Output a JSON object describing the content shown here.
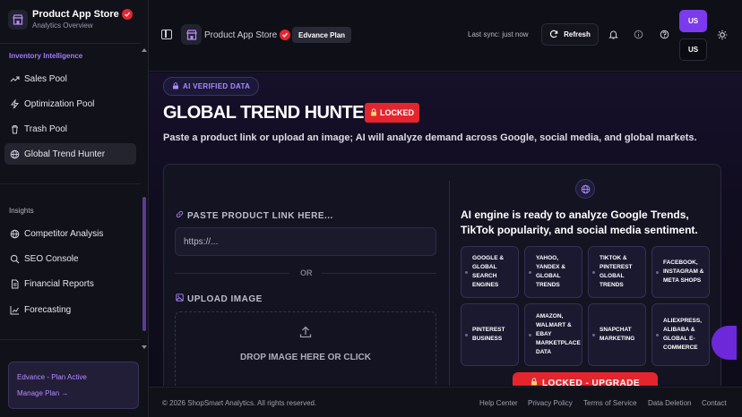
{
  "brand": {
    "title": "Product App Store",
    "subtitle": "Analytics Overview"
  },
  "sidebar": {
    "section_inventory": "Inventory Intelligence",
    "inventory_items": [
      {
        "label": "Sales Pool",
        "icon": "trending-up-icon"
      },
      {
        "label": "Optimization Pool",
        "icon": "bolt-icon"
      },
      {
        "label": "Trash Pool",
        "icon": "trash-icon"
      },
      {
        "label": "Global Trend Hunter",
        "icon": "globe-icon",
        "active": true
      }
    ],
    "section_insights": "Insights",
    "insight_items": [
      {
        "label": "Competitor Analysis",
        "icon": "globe-icon"
      },
      {
        "label": "SEO Console",
        "icon": "search-icon"
      },
      {
        "label": "Financial Reports",
        "icon": "document-icon"
      },
      {
        "label": "Forecasting",
        "icon": "chart-icon"
      }
    ],
    "plan": {
      "title": "Edvance - Plan Active",
      "link": "Manage Plan →"
    }
  },
  "topbar": {
    "app_name": "Product App Store",
    "plan_badge": "Edvance Plan",
    "sync": "Last sync: just now",
    "refresh": "Refresh",
    "lang_primary": "US",
    "lang_secondary": "US"
  },
  "main": {
    "ai_badge": "AI VERIFIED DATA",
    "title": "GLOBAL TREND HUNTER",
    "locked": "LOCKED",
    "subtitle": "Paste a product link or upload an image; AI will analyze demand across Google, social media, and global markets.",
    "link_label": "PASTE PRODUCT LINK HERE...",
    "link_placeholder": "https://...",
    "or": "OR",
    "upload_label": "UPLOAD IMAGE",
    "drop_text": "DROP IMAGE HERE OR CLICK",
    "ai_ready": "AI engine is ready to analyze Google Trends, TikTok popularity, and social media sentiment.",
    "sources": [
      [
        "GOOGLE &",
        "GLOBAL",
        "SEARCH",
        "ENGINES"
      ],
      [
        "YAHOO,",
        "YANDEX &",
        "GLOBAL",
        "TRENDS"
      ],
      [
        "TIKTOK &",
        "PINTEREST",
        "GLOBAL",
        "TRENDS"
      ],
      [
        "FACEBOOK,",
        "INSTAGRAM &",
        "META SHOPS"
      ],
      [
        "PINTEREST",
        "BUSINESS"
      ],
      [
        "AMAZON,",
        "WALMART &",
        "EBAY",
        "MARKETPLACE",
        "DATA"
      ],
      [
        "SNAPCHAT",
        "MARKETING"
      ],
      [
        "ALIEXPRESS,",
        "ALIBABA &",
        "GLOBAL E-",
        "COMMERCE"
      ]
    ],
    "upgrade": "LOCKED - UPGRADE"
  },
  "footer": {
    "copyright": "© 2026 ShopSmart Analytics.  All rights reserved.",
    "links": [
      "Help Center",
      "Privacy Policy",
      "Terms of Service",
      "Data Deletion",
      "Contact"
    ]
  },
  "colors": {
    "accent": "#7c3aed",
    "accent_text": "#b48cff",
    "danger": "#e5252e",
    "background": "#0b0b14"
  }
}
